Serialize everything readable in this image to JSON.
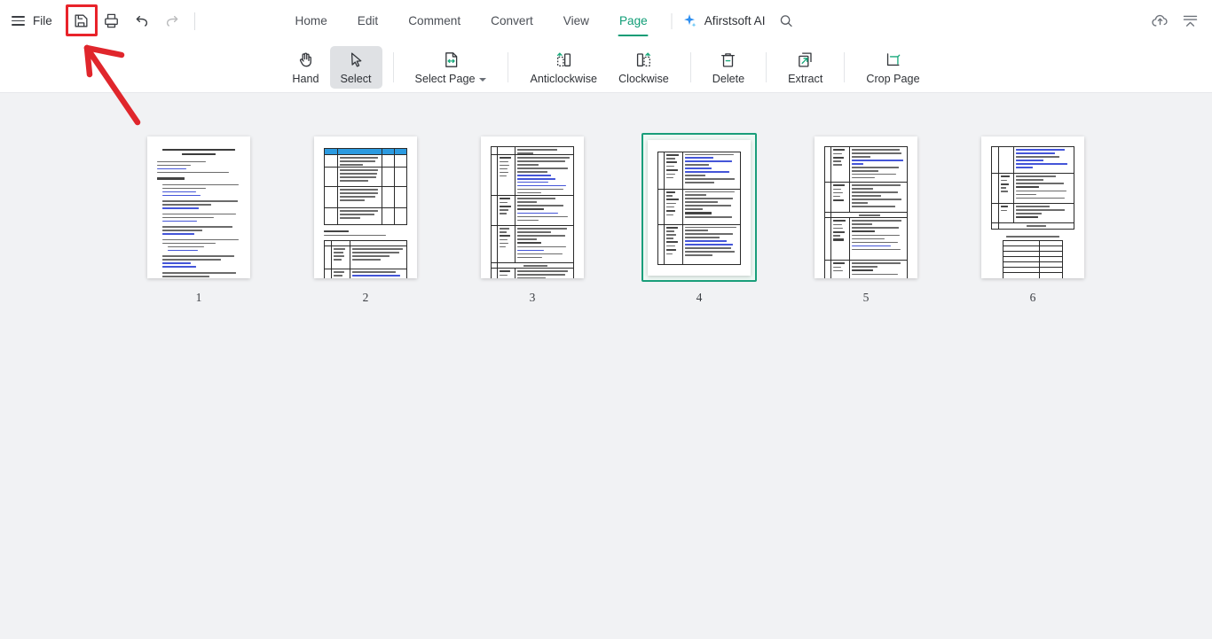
{
  "app": {
    "brand": "Afirstsoft AI"
  },
  "topbar": {
    "file_label": "File",
    "quick_tools": [
      {
        "name": "save-icon",
        "label": "Save",
        "disabled": false
      },
      {
        "name": "print-icon",
        "label": "Print",
        "disabled": false
      },
      {
        "name": "undo-icon",
        "label": "Undo",
        "disabled": false
      },
      {
        "name": "redo-icon",
        "label": "Redo",
        "disabled": true
      }
    ],
    "tabs": [
      {
        "label": "Home",
        "active": false
      },
      {
        "label": "Edit",
        "active": false
      },
      {
        "label": "Comment",
        "active": false
      },
      {
        "label": "Convert",
        "active": false
      },
      {
        "label": "View",
        "active": false
      },
      {
        "label": "Page",
        "active": true
      }
    ],
    "search_icon": "search-icon",
    "ai_icon": "sparkle-icon",
    "right_icons": [
      {
        "name": "cloud-upload-icon"
      },
      {
        "name": "collapse-ribbon-icon"
      }
    ]
  },
  "ribbon": {
    "items": [
      {
        "label": "Hand",
        "icon": "hand-icon",
        "selected": false,
        "dropdown": false
      },
      {
        "label": "Select",
        "icon": "cursor-arrow-icon",
        "selected": true,
        "dropdown": false
      },
      {
        "label": "Select Page",
        "icon": "select-page-icon",
        "selected": false,
        "dropdown": true
      },
      {
        "label": "Anticlockwise",
        "icon": "rotate-anticlockwise-icon",
        "selected": false,
        "dropdown": false
      },
      {
        "label": "Clockwise",
        "icon": "rotate-clockwise-icon",
        "selected": false,
        "dropdown": false
      },
      {
        "label": "Delete",
        "icon": "trash-icon",
        "selected": false,
        "dropdown": false
      },
      {
        "label": "Extract",
        "icon": "extract-icon",
        "selected": false,
        "dropdown": false
      },
      {
        "label": "Crop Page",
        "icon": "crop-icon",
        "selected": false,
        "dropdown": false
      }
    ]
  },
  "pages": [
    {
      "number": "1",
      "selected": false,
      "kind": "text"
    },
    {
      "number": "2",
      "selected": false,
      "kind": "table-blue-header"
    },
    {
      "number": "3",
      "selected": false,
      "kind": "table-links"
    },
    {
      "number": "4",
      "selected": true,
      "kind": "table-links"
    },
    {
      "number": "5",
      "selected": false,
      "kind": "table-links"
    },
    {
      "number": "6",
      "selected": false,
      "kind": "table-summary"
    }
  ],
  "annotation": {
    "highlight_target": "save-icon",
    "highlight_color": "#e8232a",
    "arrow_color": "#e0262c",
    "arrow_description": "red arrow pointing up-left at the save button"
  },
  "colors": {
    "accent_green": "#0f9d76",
    "selection_green": "#1a9e7a",
    "annotation_red": "#e8232a",
    "workspace_bg": "#f1f2f4",
    "chrome_bg": "#ffffff"
  }
}
